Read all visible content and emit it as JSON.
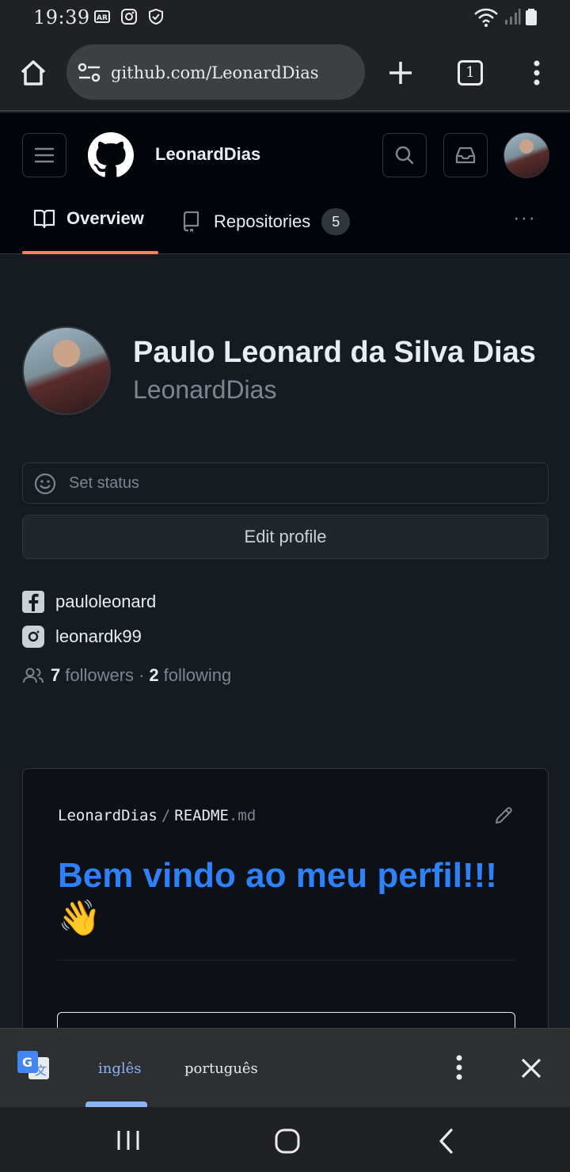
{
  "status_bar": {
    "time": "19:39"
  },
  "browser": {
    "url": "github.com/LeonardDias",
    "tab_count": "1"
  },
  "github_header": {
    "username": "LeonardDias",
    "tabs": [
      {
        "label": "Overview",
        "active": true
      },
      {
        "label": "Repositories",
        "count": "5"
      }
    ],
    "more_glyph": "···"
  },
  "profile": {
    "name": "Paulo Leonard da Silva Dias",
    "login": "LeonardDias",
    "set_status_label": "Set status",
    "edit_profile_label": "Edit profile",
    "social": [
      {
        "icon": "facebook-icon",
        "handle": "pauloleonard"
      },
      {
        "icon": "instagram-icon",
        "handle": "leonardk99"
      }
    ],
    "followers_count": "7",
    "followers_label": "followers",
    "separator": "·",
    "following_count": "2",
    "following_label": "following"
  },
  "readme": {
    "owner": "LeonardDias",
    "separator": "/",
    "file_name": "README",
    "file_ext": ".md",
    "heading": "Bem vindo ao meu perfil!!!",
    "emoji": "👋"
  },
  "translate_bar": {
    "languages": [
      {
        "label": "inglês",
        "selected": true
      },
      {
        "label": "português",
        "selected": false
      }
    ]
  },
  "colors": {
    "accent_blue": "#2f81f7",
    "tab_underline": "#f78166",
    "translate_selected": "#8ab4f8"
  }
}
